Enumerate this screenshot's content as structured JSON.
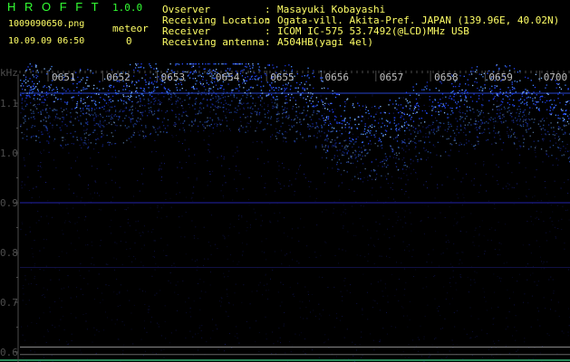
{
  "app": {
    "name": "H R O F F T",
    "version": "1.0.0",
    "file_name": "1009090650.png",
    "timestamp": "10.09.09 06:50",
    "meteor_label": "meteor",
    "meteor_count": "0"
  },
  "info": [
    {
      "label": "Ovserver",
      "value": "Masayuki Kobayashi"
    },
    {
      "label": "Receiving Location",
      "value": "Ogata-vill. Akita-Pref. JAPAN (139.96E, 40.02N)"
    },
    {
      "label": "Receiver",
      "value": "ICOM IC-575 53.7492(@LCD)MHz USB"
    },
    {
      "label": "Receiving antenna",
      "value": "A504HB(yagi 4el)"
    }
  ],
  "separator": ":",
  "spectrogram": {
    "y_unit": "kHz",
    "y_ticks": [
      "1.1",
      "1.0",
      "0.9",
      "0.8",
      "0.7",
      "0.6"
    ],
    "y_range": [
      0.58,
      1.18
    ],
    "x_ticks": [
      "0651",
      "0652",
      "0653",
      "0654",
      "0655",
      "0656",
      "0657",
      "0658",
      "0659",
      "0700"
    ],
    "colors": {
      "header_green": "#33ff33",
      "header_yellow": "#ffff66",
      "axis_grid": "#4d4d4d",
      "signal": "#3355ff",
      "reference_line": "#2222aa"
    }
  }
}
